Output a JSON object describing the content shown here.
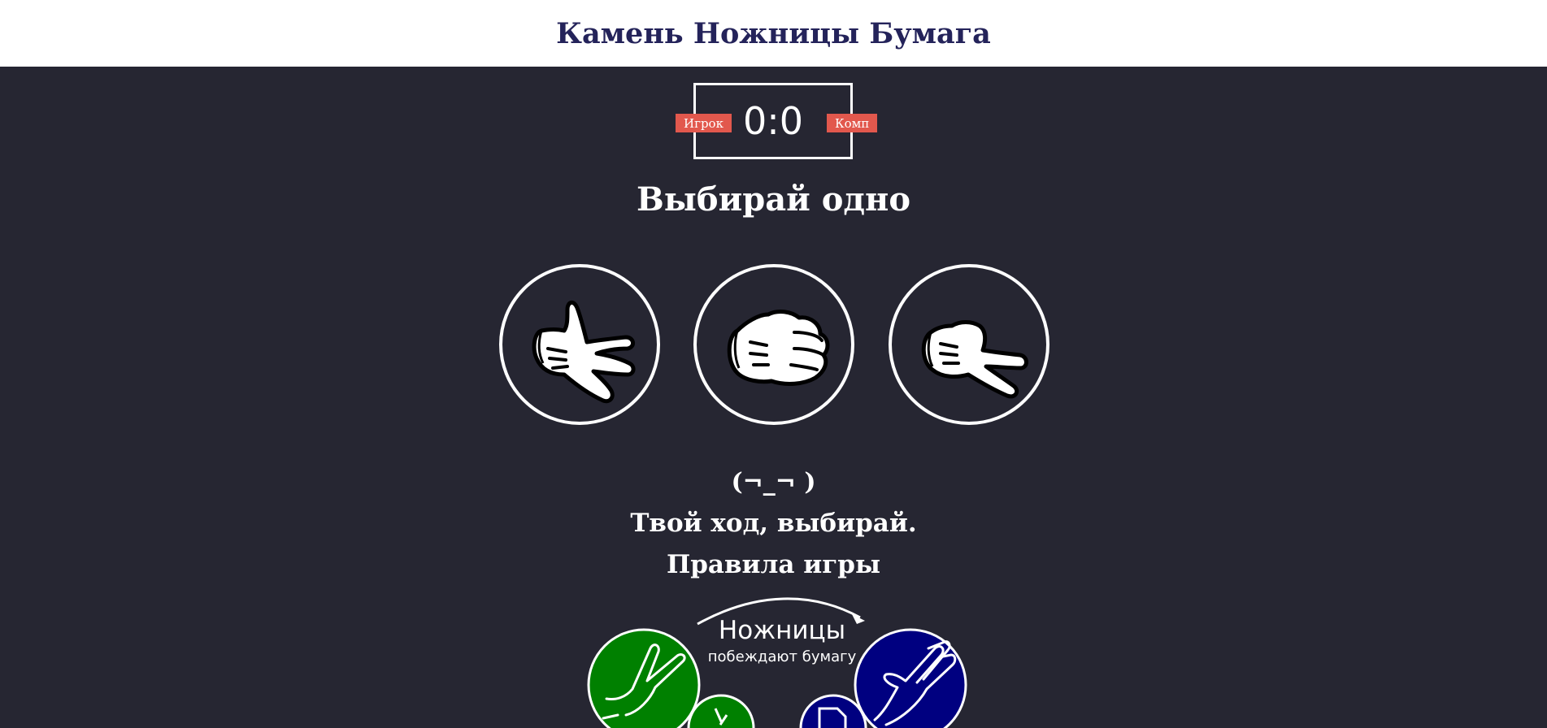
{
  "header": {
    "title": "Камень Ножницы Бумага"
  },
  "score": {
    "user_label": "Игрок",
    "comp_label": "Комп",
    "user": 0,
    "comp": 0,
    "display": "0:0"
  },
  "prompt": "Выбирай одно",
  "choices": [
    {
      "id": "paper",
      "icon": "hand-open-icon"
    },
    {
      "id": "rock",
      "icon": "fist-icon"
    },
    {
      "id": "scissors",
      "icon": "two-fingers-icon"
    }
  ],
  "status": {
    "face": "(¬_¬ )",
    "message": "Твой ход, выбирай."
  },
  "rules": {
    "heading": "Правила игры",
    "line1": "Ножницы",
    "line2": "побеждают бумагу"
  },
  "colors": {
    "background": "#262632",
    "header_bg": "#ffffff",
    "title_color": "#24235a",
    "badge": "#e2584d",
    "rule_green": "#008000",
    "rule_blue": "#000080"
  }
}
